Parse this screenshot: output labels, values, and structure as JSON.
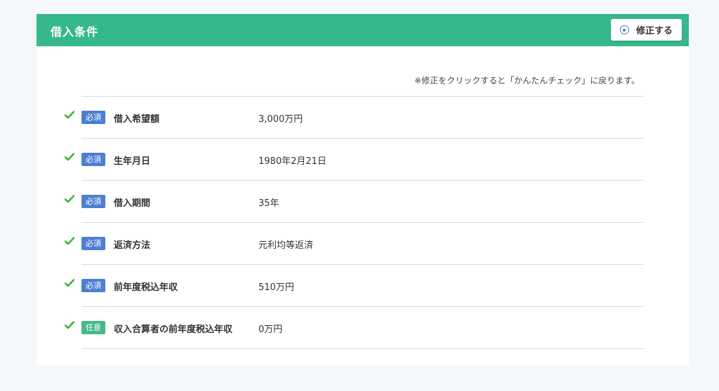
{
  "panel": {
    "title": "借入条件",
    "edit_button_label": "修正する",
    "note": "※修正をクリックすると「かんたんチェック」に戻ります。"
  },
  "rows": [
    {
      "badge": "必須",
      "badge_type": "required",
      "label": "借入希望額",
      "value": "3,000万円"
    },
    {
      "badge": "必須",
      "badge_type": "required",
      "label": "生年月日",
      "value": "1980年2月21日"
    },
    {
      "badge": "必須",
      "badge_type": "required",
      "label": "借入期間",
      "value": "35年"
    },
    {
      "badge": "必須",
      "badge_type": "required",
      "label": "返済方法",
      "value": "元利均等返済"
    },
    {
      "badge": "必須",
      "badge_type": "required",
      "label": "前年度税込年収",
      "value": "510万円"
    },
    {
      "badge": "任意",
      "badge_type": "optional",
      "label": "収入合算者の前年度税込年収",
      "value": "0万円"
    }
  ],
  "colors": {
    "header": "#35b98a",
    "required_badge": "#4d7fd3",
    "optional_badge": "#45b98b",
    "check": "#3ab53a",
    "page_bg": "#f4f8fb"
  },
  "icons": {
    "edit": "circle-dot-icon",
    "row_status": "check-icon"
  }
}
